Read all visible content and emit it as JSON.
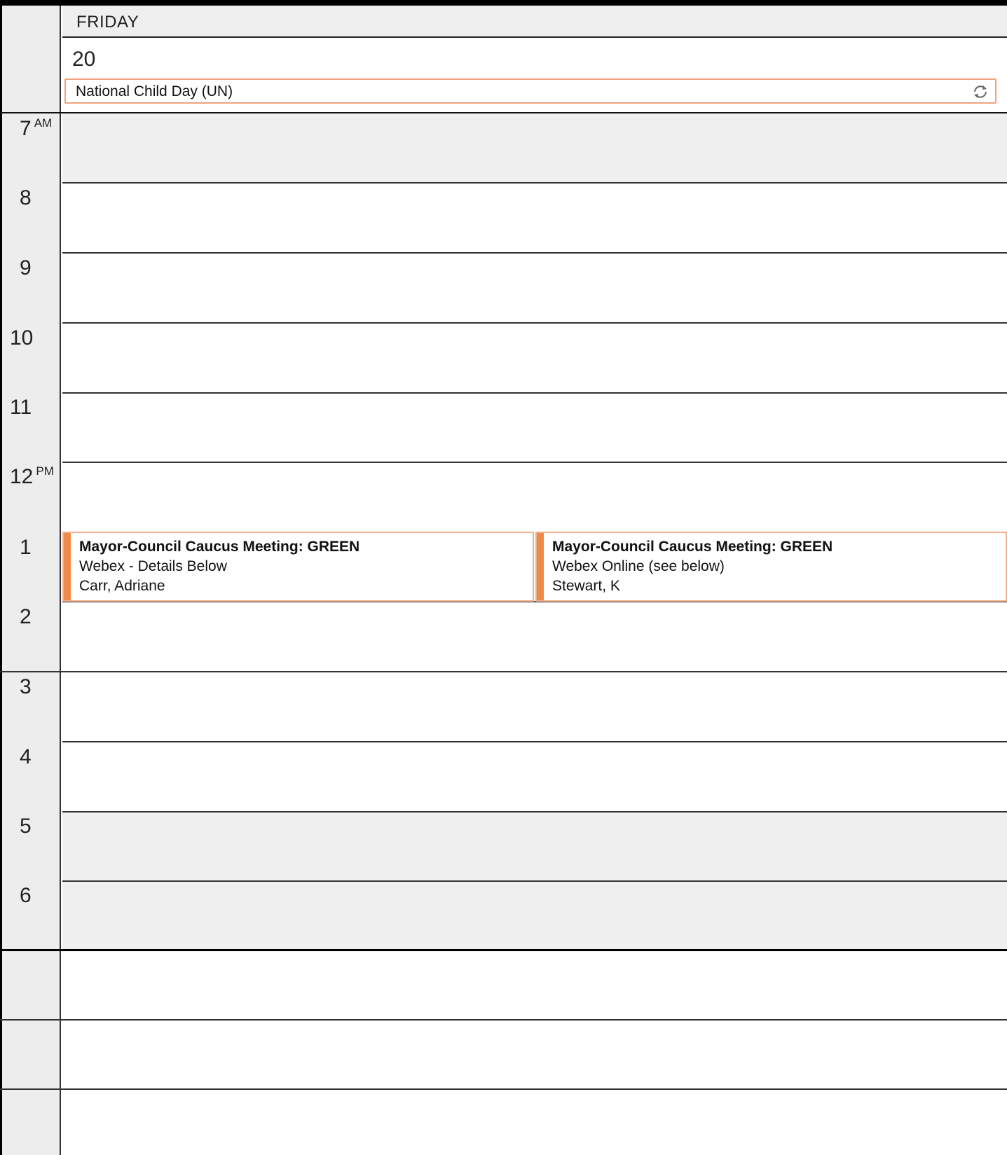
{
  "day": {
    "name": "FRIDAY",
    "number": "20"
  },
  "all_day_event": {
    "title": "National Child Day (UN)",
    "icon": "recurring-icon"
  },
  "hours": [
    {
      "label": "7",
      "suffix": "AM"
    },
    {
      "label": "8",
      "suffix": ""
    },
    {
      "label": "9",
      "suffix": ""
    },
    {
      "label": "10",
      "suffix": ""
    },
    {
      "label": "11",
      "suffix": ""
    },
    {
      "label": "12",
      "suffix": "PM"
    },
    {
      "label": "1",
      "suffix": ""
    },
    {
      "label": "2",
      "suffix": ""
    },
    {
      "label": "3",
      "suffix": ""
    },
    {
      "label": "4",
      "suffix": ""
    },
    {
      "label": "5",
      "suffix": ""
    },
    {
      "label": "6",
      "suffix": ""
    }
  ],
  "events": [
    {
      "title": "Mayor-Council Caucus Meeting: GREEN",
      "location": "Webex - Details Below",
      "organizer": "Carr, Adriane"
    },
    {
      "title": "Mayor-Council Caucus Meeting: GREEN",
      "location": "Webex Online (see below)",
      "organizer": "Stewart, K"
    }
  ],
  "colors": {
    "event_accent": "#f08a4b",
    "event_border": "#f2b08f",
    "off_hours_bg": "#efefef"
  }
}
